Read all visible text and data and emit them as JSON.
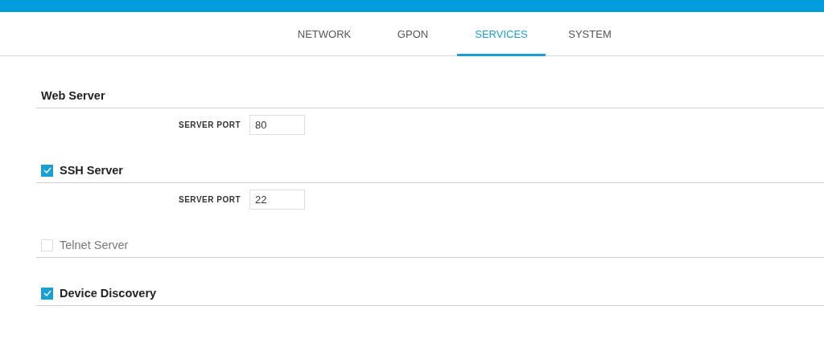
{
  "tabs": [
    {
      "label": "NETWORK",
      "selected": false
    },
    {
      "label": "GPON",
      "selected": false
    },
    {
      "label": "SERVICES",
      "selected": true
    },
    {
      "label": "SYSTEM",
      "selected": false
    }
  ],
  "sections": [
    {
      "kind": "heading",
      "title": "Web Server",
      "fields": [
        {
          "label": "SERVER PORT",
          "value": "80"
        }
      ]
    },
    {
      "kind": "checkbox",
      "title": "SSH Server",
      "checked": true,
      "fields": [
        {
          "label": "SERVER PORT",
          "value": "22"
        }
      ]
    },
    {
      "kind": "checkbox",
      "title": "Telnet Server",
      "checked": false
    },
    {
      "kind": "checkbox",
      "title": "Device Discovery",
      "checked": true
    }
  ]
}
